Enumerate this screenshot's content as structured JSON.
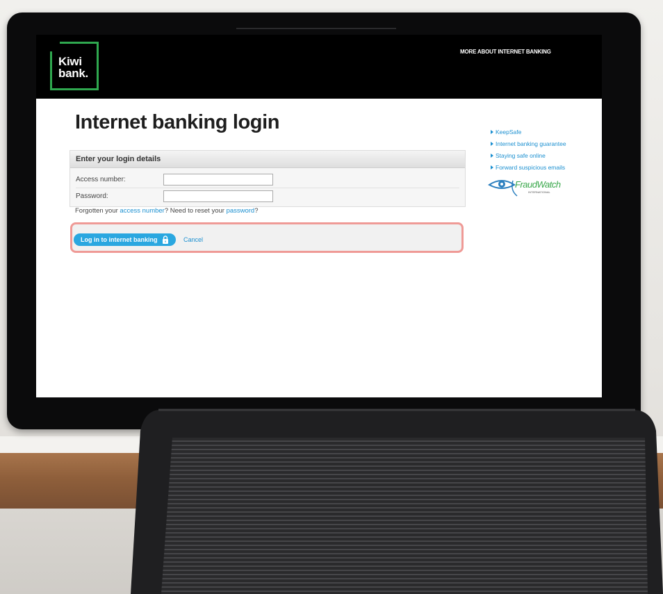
{
  "header": {
    "logo_line1": "Kiwi",
    "logo_line2": "bank.",
    "top_link": "MORE ABOUT INTERNET BANKING"
  },
  "page": {
    "title": "Internet banking login"
  },
  "login": {
    "panel_title": "Enter your login details",
    "access_label": "Access number:",
    "access_value": "",
    "password_label": "Password:",
    "password_value": "",
    "help_prefix": "Forgotten your ",
    "help_access_link": "access number",
    "help_middle": "? Need to reset your ",
    "help_password_link": "password",
    "help_suffix": "?",
    "login_button": "Log in to internet banking",
    "cancel_link": "Cancel"
  },
  "sidebar": {
    "links": [
      "KeepSafe",
      "Internet banking guarantee",
      "Staying safe online",
      "Forward suspicious emails"
    ],
    "fraudwatch_label": "FraudWatch",
    "fraudwatch_sub": "INTERNATIONAL"
  },
  "colors": {
    "brand_green": "#2fa84f",
    "link_blue": "#1a8fd0",
    "button_blue": "#2aa7e0",
    "highlight_border": "#ef9a96"
  }
}
